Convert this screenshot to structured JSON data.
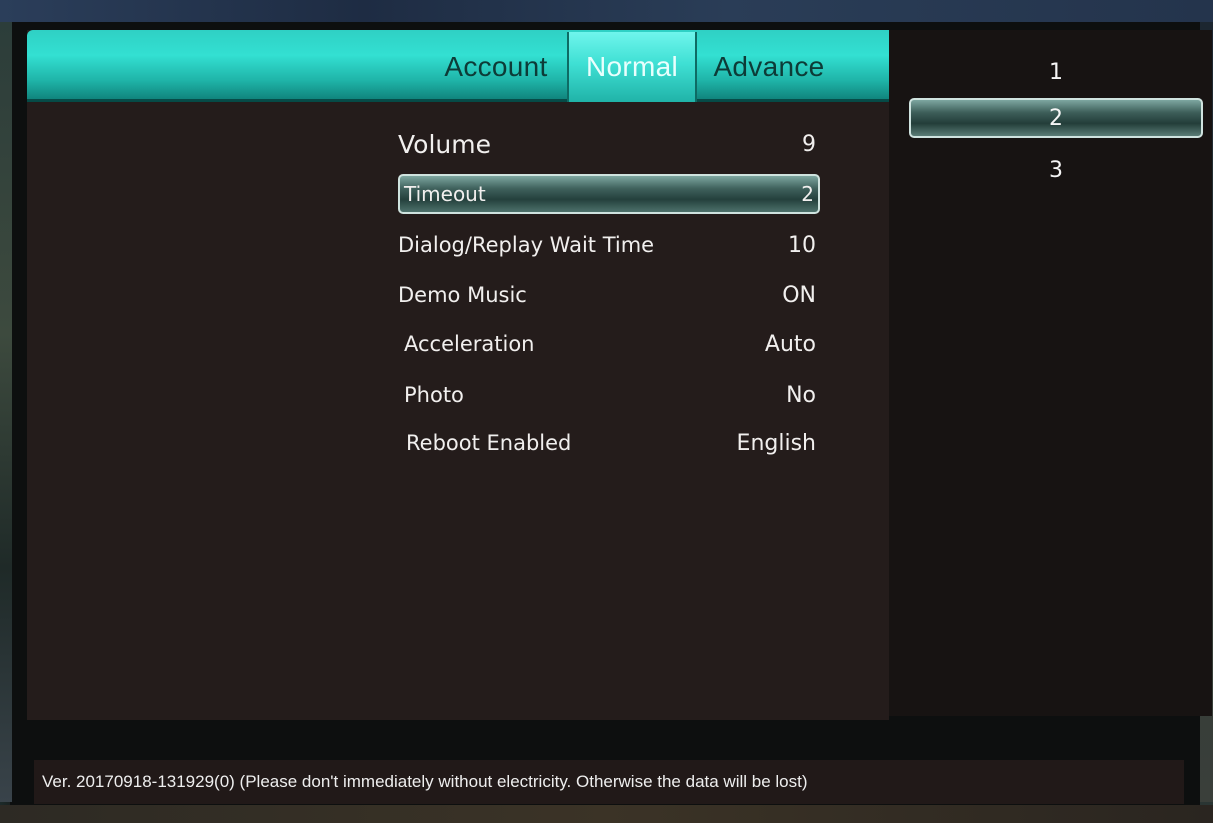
{
  "tabs": [
    {
      "label": "Account"
    },
    {
      "label": "Normal"
    },
    {
      "label": "Advance"
    }
  ],
  "active_tab": "Normal",
  "settings": [
    {
      "label": "Volume",
      "value": "9"
    },
    {
      "label": "Timeout",
      "value": "2"
    },
    {
      "label": "Dialog/Replay Wait Time",
      "value": "10"
    },
    {
      "label": "Demo Music",
      "value": "ON"
    },
    {
      "label": "Acceleration",
      "value": "Auto"
    },
    {
      "label": "Photo",
      "value": "No"
    },
    {
      "label": "Reboot Enabled",
      "value": "English"
    }
  ],
  "selected_setting": "Timeout",
  "options": [
    "1",
    "2",
    "3"
  ],
  "selected_option": "2",
  "footer": {
    "text": "Ver. 20170918-131929(0) (Please don't immediately without electricity. Otherwise the data will be lost)"
  },
  "colors": {
    "tab_accent": "#33e0d2",
    "panel_bg": "#241c1b",
    "selection": "#3f615c"
  }
}
